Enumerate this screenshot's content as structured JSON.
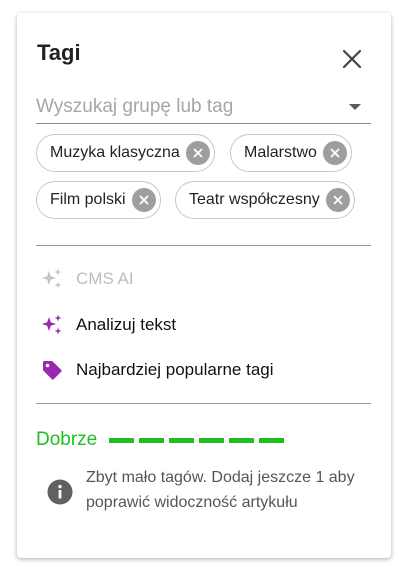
{
  "panel": {
    "title": "Tagi",
    "close_icon": "close-icon"
  },
  "search": {
    "placeholder": "Wyszukaj grupę lub tag",
    "value": "",
    "dropdown_icon": "dropdown-arrow-icon"
  },
  "tags": [
    {
      "label": "Muzyka klasyczna"
    },
    {
      "label": "Malarstwo"
    },
    {
      "label": "Film polski"
    },
    {
      "label": "Teatr współczesny"
    }
  ],
  "actions": {
    "cms_ai": {
      "label": "CMS AI",
      "icon": "sparkles-icon",
      "enabled": false
    },
    "analyze": {
      "label": "Analizuj tekst",
      "icon": "sparkles-icon",
      "enabled": true
    },
    "popular": {
      "label": "Najbardziej popularne tagi",
      "icon": "tag-icon",
      "enabled": true
    }
  },
  "quality": {
    "label": "Dobrze",
    "filled_segments": 6,
    "total_segments": 6,
    "color": "#1fbf1f"
  },
  "hint": {
    "icon": "info-icon",
    "text": "Zbyt mało tagów. Dodaj jeszcze 1 aby poprawić widoczność artykułu"
  },
  "colors": {
    "accent_purple": "#9c27b0",
    "success_green": "#1fbf1f",
    "chip_remove_grey": "#9e9e9e",
    "disabled_grey": "#bdbdbd"
  }
}
